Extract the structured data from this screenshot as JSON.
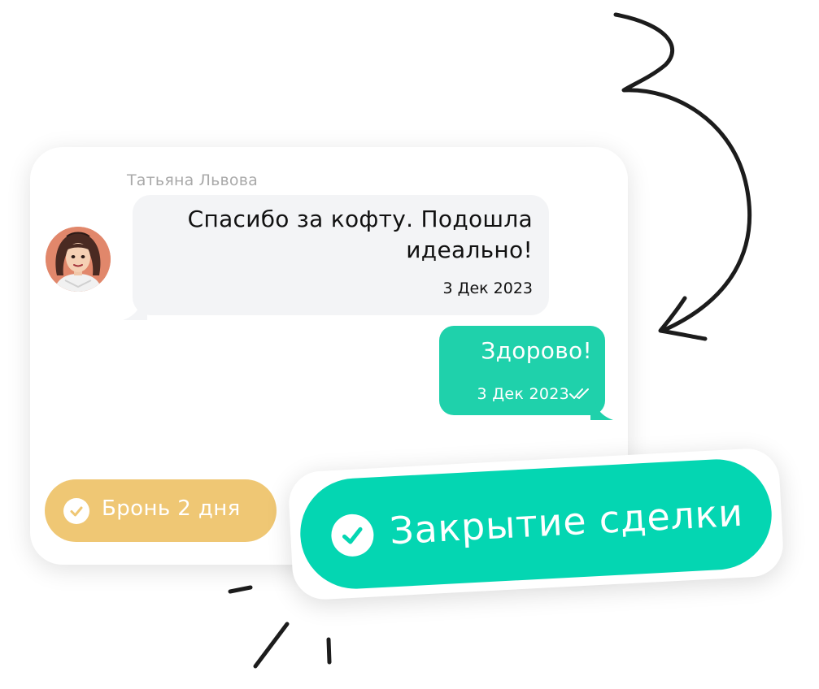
{
  "chat": {
    "sender_name": "Татьяна Львова",
    "incoming_message": {
      "text": "Спасибо за кофту. Подошла идеально!",
      "time": "3 Дек 2023"
    },
    "outgoing_message": {
      "text": "Здорово!",
      "time": "3 Дек 2023",
      "status_icon": "double-check-icon"
    }
  },
  "tags": {
    "booking": {
      "label": "Бронь 2 дня",
      "icon": "check-circle-icon"
    },
    "deal_closing": {
      "label": "Закрытие сделки",
      "icon": "check-circle-icon"
    }
  },
  "colors": {
    "outgoing_bubble": "#1fd1ab",
    "incoming_bubble": "#f3f4f6",
    "booking_tag": "#efc774",
    "deal_tag": "#04d6b2",
    "sender_name": "#a9a9a9"
  }
}
